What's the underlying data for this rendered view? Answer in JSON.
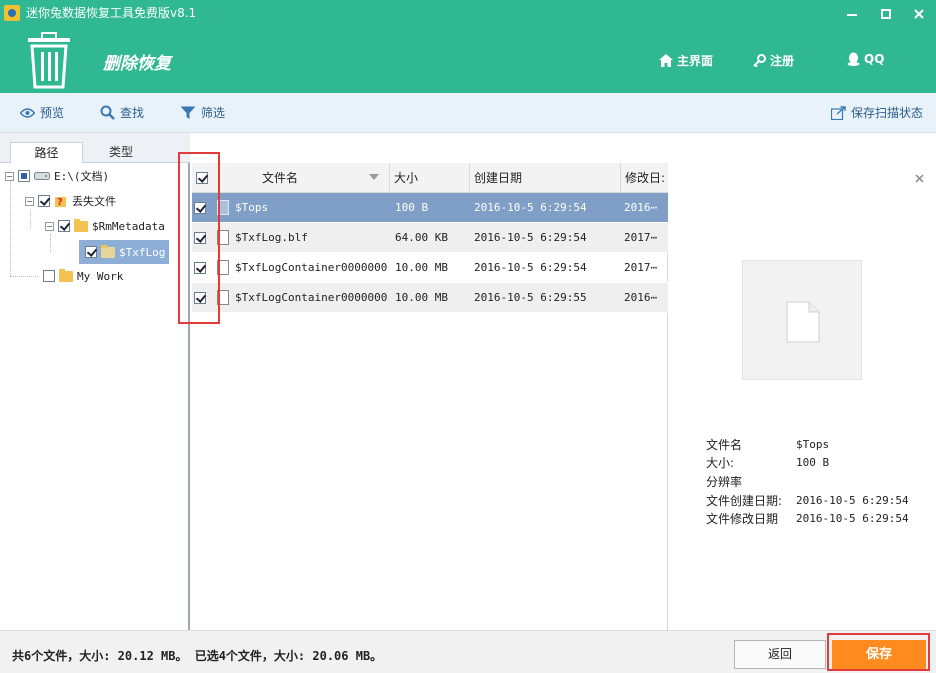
{
  "window": {
    "title": "迷你兔数据恢复工具免费版v8.1"
  },
  "header": {
    "section_title": "删除恢复",
    "nav": {
      "home": "主界面",
      "register": "注册",
      "qq": "QQ"
    }
  },
  "toolbar": {
    "preview": "预览",
    "search": "查找",
    "filter": "筛选",
    "save_state": "保存扫描状态"
  },
  "tabs": {
    "path": "路径",
    "type": "类型"
  },
  "tree": {
    "drive": "E:\\(文档)",
    "lost_files": "丢失文件",
    "rm_metadata": "$RmMetadata",
    "txflog": "$TxfLog",
    "my_work": "My Work"
  },
  "table": {
    "headers": {
      "name": "文件名",
      "size": "大小",
      "created": "创建日期",
      "modified": "修改日:"
    },
    "rows": [
      {
        "name": "$Tops",
        "size": "100 B",
        "created": "2016-10-5 6:29:54",
        "modified": "2016⋯",
        "checked": true,
        "selected": true
      },
      {
        "name": "$TxfLog.blf",
        "size": "64.00 KB",
        "created": "2016-10-5 6:29:54",
        "modified": "2017⋯",
        "checked": true
      },
      {
        "name": "$TxfLogContainer0000000⋯",
        "size": "10.00 MB",
        "created": "2016-10-5 6:29:54",
        "modified": "2017⋯",
        "checked": true
      },
      {
        "name": "$TxfLogContainer0000000⋯",
        "size": "10.00 MB",
        "created": "2016-10-5 6:29:55",
        "modified": "2016⋯",
        "checked": true
      }
    ]
  },
  "preview": {
    "labels": {
      "name": "文件名",
      "size": "大小:",
      "resolution": "分辨率",
      "created": "文件创建日期:",
      "modified": "文件修改日期"
    },
    "values": {
      "name": "$Tops",
      "size": "100 B",
      "created": "2016-10-5 6:29:54",
      "modified": "2016-10-5 6:29:54"
    }
  },
  "footer": {
    "status": "共6个文件，大小: 20.12 MB。 已选4个文件，大小: 20.06 MB。",
    "back": "返回",
    "save": "保存"
  },
  "colors": {
    "header": "#2fb891",
    "save_button": "#ff8a1e",
    "highlight": "#e23b3b"
  }
}
